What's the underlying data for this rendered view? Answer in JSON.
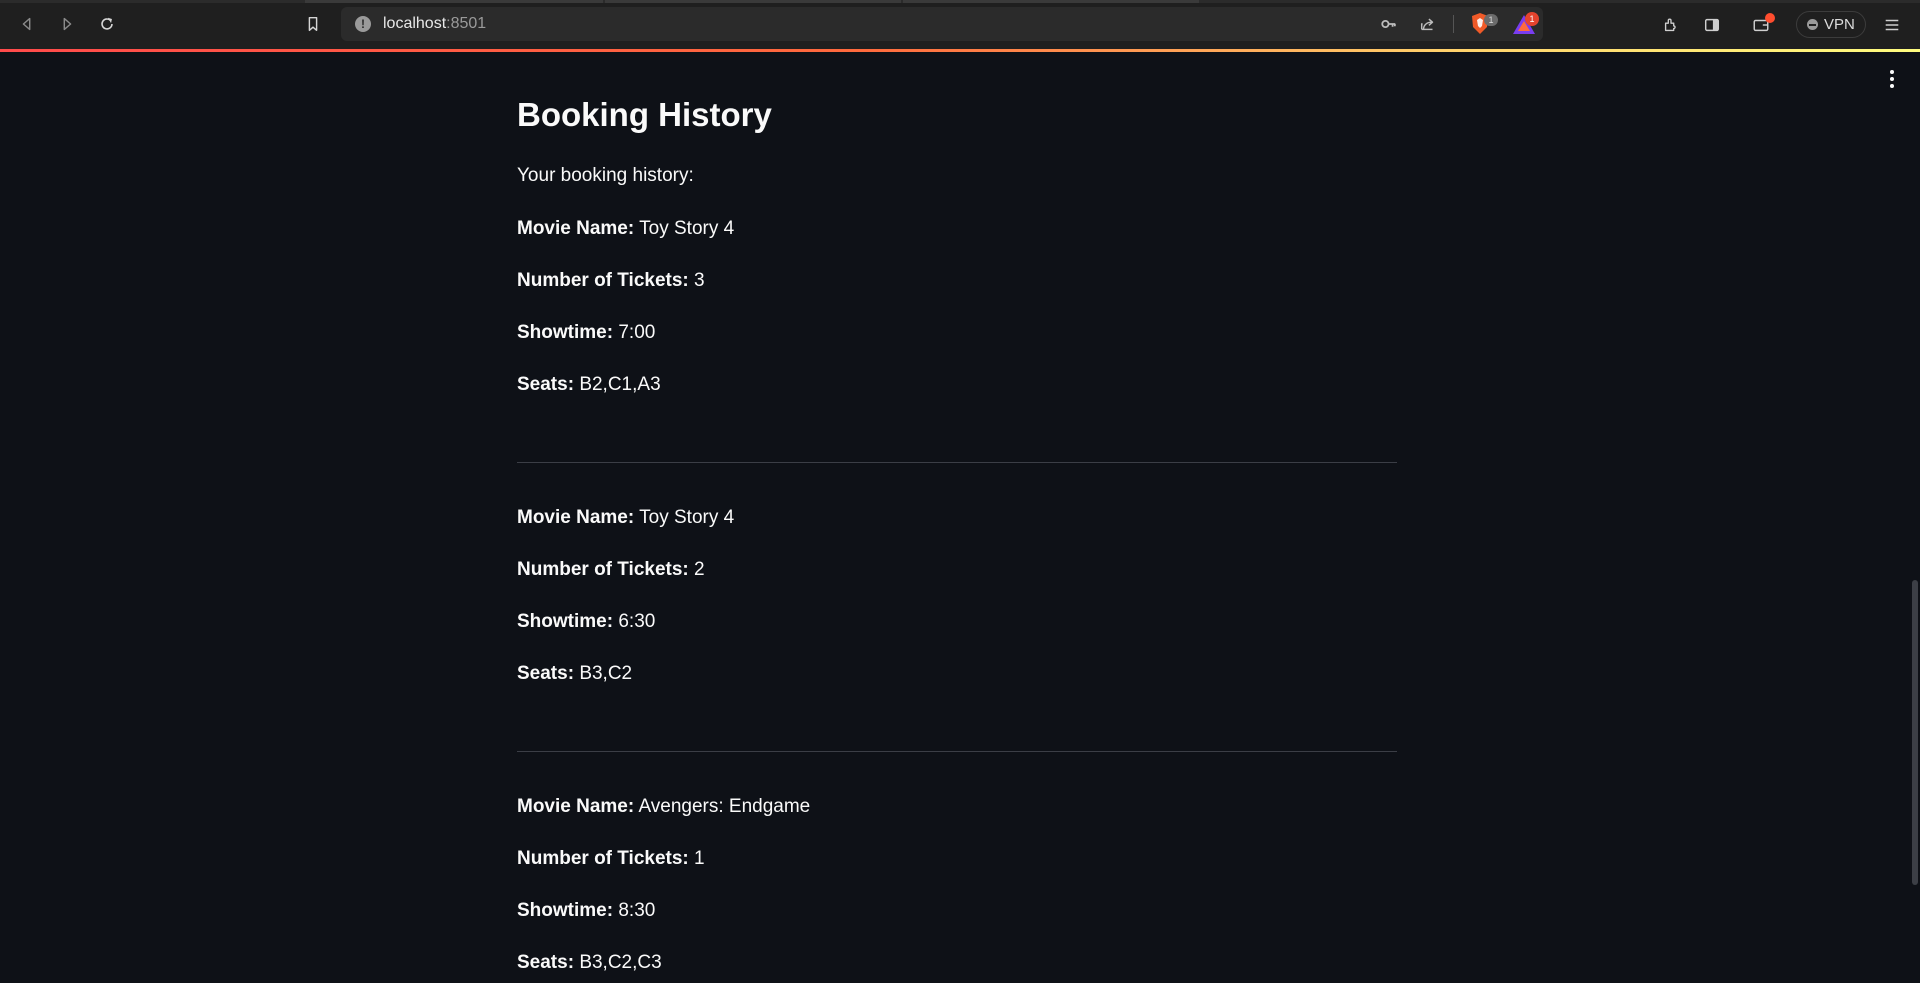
{
  "browser": {
    "url_host": "localhost",
    "url_port": ":8501",
    "shield_badge": "1",
    "rewards_badge": "1",
    "vpn_label": "VPN"
  },
  "page": {
    "title": "Booking History",
    "intro": "Your booking history:",
    "labels": {
      "movie": "Movie Name:",
      "tickets": "Number of Tickets:",
      "showtime": "Showtime:",
      "seats": "Seats:"
    },
    "bookings": [
      {
        "movie": "Toy Story 4",
        "tickets": "3",
        "showtime": "7:00",
        "seats": "B2,C1,A3"
      },
      {
        "movie": "Toy Story 4",
        "tickets": "2",
        "showtime": "6:30",
        "seats": "B3,C2"
      },
      {
        "movie": "Avengers: Endgame",
        "tickets": "1",
        "showtime": "8:30",
        "seats": "B3,C2,C3"
      }
    ]
  },
  "theme": {
    "background": "#0e1117",
    "text": "#fafafa",
    "divider": "#3b3e46",
    "accent_gradient_start": "#ff4b4b",
    "accent_gradient_end": "#fffd80"
  },
  "icons": [
    "back-icon",
    "forward-icon",
    "reload-icon",
    "bookmark-icon",
    "site-info-icon",
    "key-icon",
    "share-icon",
    "brave-shield-icon",
    "brave-rewards-icon",
    "extensions-icon",
    "sidebar-icon",
    "wallet-icon",
    "vpn-icon",
    "menu-icon",
    "more-options-icon"
  ]
}
